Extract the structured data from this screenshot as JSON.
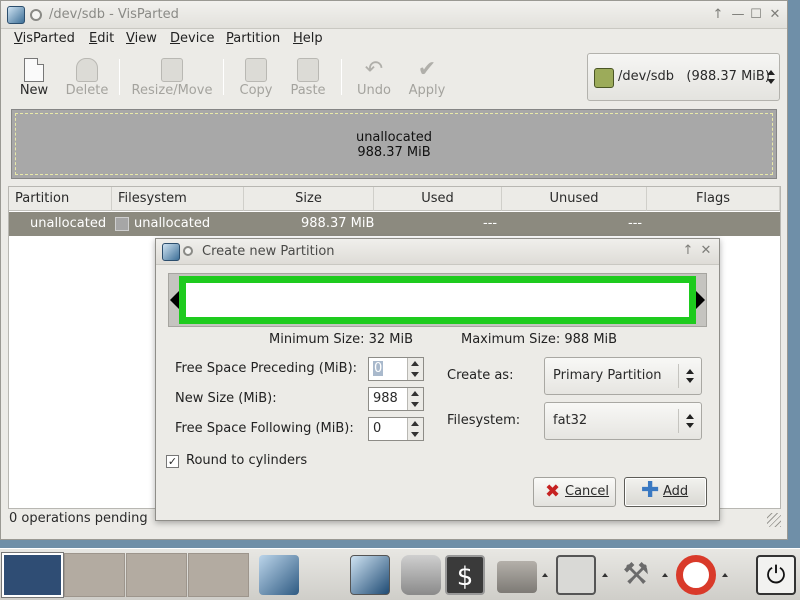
{
  "window": {
    "title": "/dev/sdb - VisParted",
    "controls": {
      "up": "↑",
      "minimize": "—",
      "maximize": "☐",
      "close": "✕"
    }
  },
  "menubar": {
    "items": [
      {
        "label": "VisParted",
        "mnemonic": "V",
        "rest": "isParted"
      },
      {
        "label": "Edit",
        "mnemonic": "E",
        "rest": "dit"
      },
      {
        "label": "View",
        "mnemonic": "V",
        "rest": "iew"
      },
      {
        "label": "Device",
        "mnemonic": "D",
        "rest": "evice"
      },
      {
        "label": "Partition",
        "mnemonic": "P",
        "rest": "artition"
      },
      {
        "label": "Help",
        "mnemonic": "H",
        "rest": "elp"
      }
    ]
  },
  "toolbar": {
    "new": "New",
    "delete": "Delete",
    "resize_move": "Resize/Move",
    "copy": "Copy",
    "paste": "Paste",
    "undo": "Undo",
    "apply": "Apply"
  },
  "device_selector": {
    "value": "/dev/sdb   (988.37 MiB)"
  },
  "graph": {
    "label": "unallocated",
    "size": "988.37 MiB"
  },
  "table": {
    "headers": [
      "Partition",
      "Filesystem",
      "Size",
      "Used",
      "Unused",
      "Flags"
    ],
    "rows": [
      {
        "partition": "unallocated",
        "filesystem": "unallocated",
        "size": "988.37 MiB",
        "used": "---",
        "unused": "---",
        "flags": ""
      }
    ]
  },
  "status": {
    "text": "0 operations pending"
  },
  "dialog": {
    "title": "Create new Partition",
    "min_size": "Minimum Size: 32 MiB",
    "max_size": "Maximum Size: 988 MiB",
    "free_preceding_label": "Free Space Preceding (MiB):",
    "free_preceding_value": "0",
    "new_size_label": "New Size (MiB):",
    "new_size_value": "988",
    "free_following_label": "Free Space Following (MiB):",
    "free_following_value": "0",
    "round_label": "Round to cylinders",
    "round_checked": true,
    "create_as_label": "Create as:",
    "create_as_value": "Primary Partition",
    "filesystem_label": "Filesystem:",
    "filesystem_value": "fat32",
    "cancel_label": "Cancel",
    "add_label": "Add",
    "accent_color": "#1ecb1e"
  },
  "taskbar": {
    "launchers": [
      "visparted-icon",
      "camera-icon",
      "terminal-icon",
      "folder-icon",
      "network-icon",
      "tools-icon",
      "help-icon",
      "power-icon"
    ]
  }
}
